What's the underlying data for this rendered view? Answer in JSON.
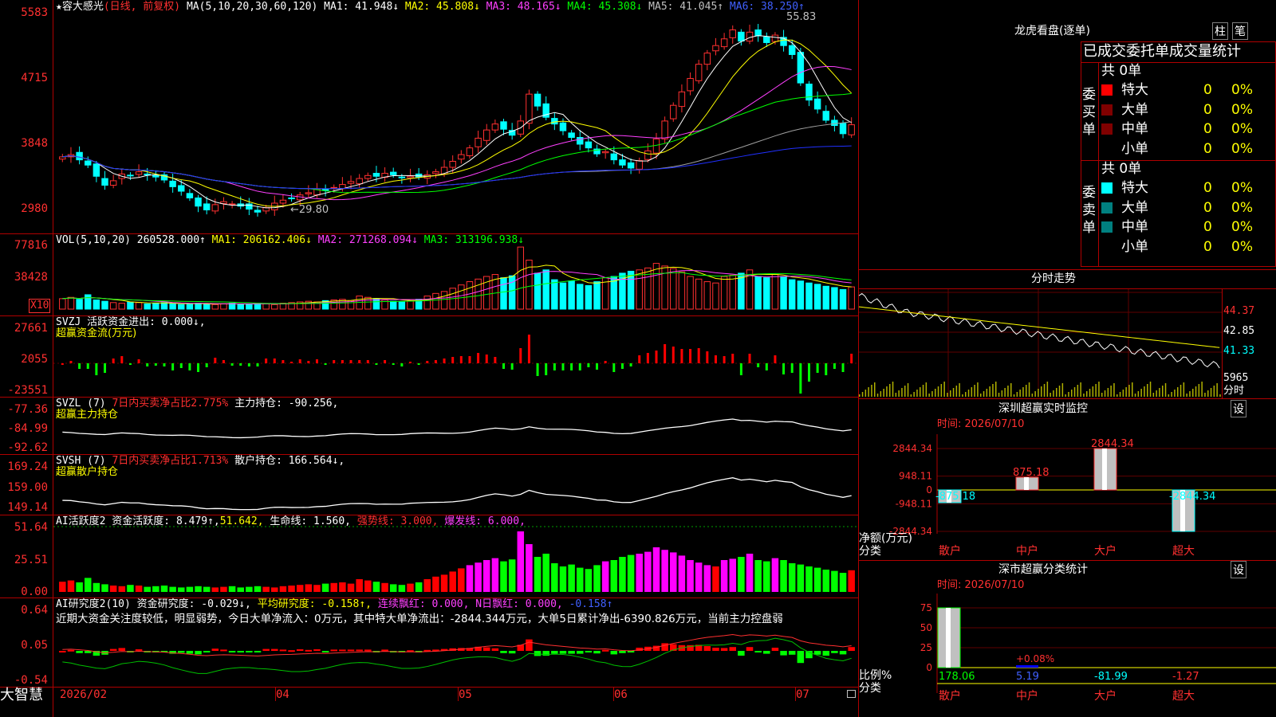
{
  "app": {
    "logo": "大智慧"
  },
  "main": {
    "stock_title": "★容大感光",
    "mode": "(日线, 前复权)",
    "ma_legend": {
      "params": "MA(5,10,20,30,60,120)",
      "ma1": "MA1: 41.948↓",
      "ma2": "MA2: 45.808↓",
      "ma3": "MA3: 48.165↓",
      "ma4": "MA4: 45.308↓",
      "ma5": "MA5: 41.045↑",
      "ma6": "MA6: 38.250↑"
    },
    "price_axis": [
      "5583",
      "4715",
      "3848",
      "2980"
    ],
    "high_mark": "55.83",
    "low_mark": "29.80",
    "vol_legend": {
      "params": "VOL(5,10,20)",
      "value": "260528.000↑",
      "ma1": "MA1: 206162.406↓",
      "ma2": "MA2: 271268.094↓",
      "ma3": "MA3: 313196.938↓"
    },
    "vol_axis": [
      "77816",
      "38428"
    ],
    "vol_unit": "X10",
    "svzj": {
      "line1": "SVZJ  活跃资金进出: 0.000↓,",
      "line2": "超赢资金流(万元)",
      "axis": [
        "27661",
        "2055",
        "-23551"
      ]
    },
    "svzl": {
      "label": "SVZL (7)",
      "ratio": "7日内买卖净占比2.775%",
      "hold": "主力持仓: -90.256,",
      "name": "超赢主力持仓",
      "axis": [
        "-77.36",
        "-84.99",
        "-92.62"
      ]
    },
    "svsh": {
      "label": "SVSH (7)",
      "ratio": "7日内买卖净占比1.713%",
      "hold": "散户持仓: 166.564↓,",
      "name": "超赢散户持仓",
      "axis": [
        "169.24",
        "159.00",
        "149.14"
      ]
    },
    "ai_active": {
      "label": "AI活跃度2 资金活跃度: 8.479↑,",
      "v2": "51.642,",
      "life": "生命线: 1.560,",
      "strong": "强势线: 3.000,",
      "burst": "爆发线: 6.000,",
      "axis": [
        "51.64",
        "25.51",
        "0.00"
      ]
    },
    "ai_research": {
      "label": "AI研究度2(10) 资金研究度: -0.029↓,",
      "avg": "平均研究度: -0.158↑,",
      "red1": "连续飘红: 0.000,",
      "red2": "N日飘红: 0.000,",
      "val": "-0.158↑",
      "comment": "近期大资金关注度较低，明显弱势，今日大单净流入：0万元，其中特大单净流出：-2844.344万元，大单5日累计净出-6390.826万元，当前主力控盘弱",
      "axis": [
        "0.64",
        "0.05",
        "-0.54"
      ]
    },
    "dates": [
      "2026/02",
      "04",
      "05",
      "06",
      "07"
    ]
  },
  "side": {
    "dragon_title": "龙虎看盘(逐单)",
    "tab_col": "柱",
    "tab_bi": "笔",
    "header": "已成交委托单成交量统计",
    "buy": {
      "label": "委买单",
      "total": "共 0单",
      "rows": [
        {
          "name": "特大",
          "count": "0",
          "pct": "0%",
          "color": "#ff0000"
        },
        {
          "name": "大单",
          "count": "0",
          "pct": "0%",
          "color": "#800000"
        },
        {
          "name": "中单",
          "count": "0",
          "pct": "0%",
          "color": "#800000"
        },
        {
          "name": "小单",
          "count": "0",
          "pct": "0%",
          "color": ""
        }
      ]
    },
    "sell": {
      "label": "委卖单",
      "total": "共 0单",
      "rows": [
        {
          "name": "特大",
          "count": "0",
          "pct": "0%",
          "color": "#00ffff"
        },
        {
          "name": "大单",
          "count": "0",
          "pct": "0%",
          "color": "#008080"
        },
        {
          "name": "中单",
          "count": "0",
          "pct": "0%",
          "color": "#008080"
        },
        {
          "name": "小单",
          "count": "0",
          "pct": "0%",
          "color": ""
        }
      ]
    },
    "intraday": {
      "title": "分时走势",
      "axis": [
        "44.37",
        "42.85",
        "41.33"
      ],
      "vol": "5965",
      "vol_label": "分时"
    },
    "monitor": {
      "title": "深圳超赢实时监控",
      "set": "设",
      "time": "时间: 2026/07/10",
      "axis": [
        "2844.34",
        "948.11",
        "0",
        "-948.11",
        "-2844.34"
      ],
      "bar_labels": [
        "-875.18",
        "875.18",
        "2844.34",
        "-2844.34"
      ],
      "y_title": "净额(万元)",
      "x_title": "分类",
      "cats": [
        "散户",
        "中户",
        "大户",
        "超大"
      ]
    },
    "stats": {
      "title": "深市超赢分类统计",
      "set": "设",
      "time": "时间: 2026/07/10",
      "axis": [
        "75",
        "50",
        "25",
        "0"
      ],
      "mid_label": "+0.08%",
      "values": [
        "178.06",
        "5.19",
        "-81.99",
        "-1.27"
      ],
      "y_title": "比例%",
      "x_title": "分类",
      "cats": [
        "散户",
        "中户",
        "大户",
        "超大"
      ]
    }
  },
  "chart_data": {
    "type": "candlestick",
    "price": {
      "ylim": [
        29.8,
        55.83
      ],
      "ticks": [
        55.83,
        47.15,
        38.48,
        29.8
      ]
    },
    "closes": [
      37.6,
      37.9,
      37.2,
      36.5,
      35.0,
      33.8,
      34.4,
      35.3,
      35.1,
      35.6,
      35.2,
      34.9,
      34.5,
      33.6,
      33.0,
      32.1,
      31.0,
      30.5,
      31.2,
      31.6,
      31.3,
      31.0,
      30.6,
      30.2,
      30.8,
      31.4,
      31.8,
      32.0,
      32.5,
      32.8,
      33.3,
      33.1,
      33.5,
      33.9,
      34.3,
      34.7,
      35.1,
      35.0,
      35.4,
      35.2,
      34.8,
      35.0,
      34.9,
      35.2,
      35.6,
      36.2,
      37.0,
      37.9,
      38.8,
      40.1,
      41.2,
      42.0,
      41.3,
      40.5,
      42.4,
      46.0,
      44.4,
      42.9,
      42.0,
      41.1,
      40.2,
      39.3,
      38.8,
      38.0,
      38.3,
      37.2,
      36.5,
      36.1,
      37.1,
      38.4,
      40.0,
      42.4,
      44.5,
      46.3,
      48.1,
      50.0,
      51.5,
      52.5,
      53.4,
      54.6,
      53.1,
      54.3,
      53.8,
      52.9,
      53.9,
      52.5,
      51.3,
      47.5,
      45.2,
      44.0,
      42.5,
      41.8,
      40.7,
      41.9
    ],
    "volume_relative": [
      0.16,
      0.18,
      0.15,
      0.22,
      0.14,
      0.12,
      0.1,
      0.09,
      0.11,
      0.1,
      0.08,
      0.09,
      0.1,
      0.08,
      0.07,
      0.08,
      0.09,
      0.08,
      0.07,
      0.08,
      0.09,
      0.07,
      0.08,
      0.09,
      0.08,
      0.07,
      0.09,
      0.1,
      0.11,
      0.12,
      0.11,
      0.13,
      0.14,
      0.15,
      0.13,
      0.2,
      0.18,
      0.16,
      0.14,
      0.12,
      0.11,
      0.13,
      0.15,
      0.2,
      0.24,
      0.27,
      0.32,
      0.37,
      0.42,
      0.46,
      0.5,
      0.53,
      0.48,
      0.51,
      0.95,
      0.75,
      0.55,
      0.6,
      0.45,
      0.4,
      0.43,
      0.38,
      0.36,
      0.42,
      0.48,
      0.5,
      0.55,
      0.58,
      0.6,
      0.63,
      0.7,
      0.66,
      0.62,
      0.57,
      0.5,
      0.46,
      0.42,
      0.4,
      0.5,
      0.52,
      0.55,
      0.6,
      0.5,
      0.48,
      0.53,
      0.5,
      0.45,
      0.43,
      0.4,
      0.38,
      0.35,
      0.33,
      0.3,
      0.34
    ],
    "up_down": "closes vs previous",
    "intraday": {
      "ylim": [
        40.6,
        44.9
      ],
      "ref": 42.85
    }
  }
}
